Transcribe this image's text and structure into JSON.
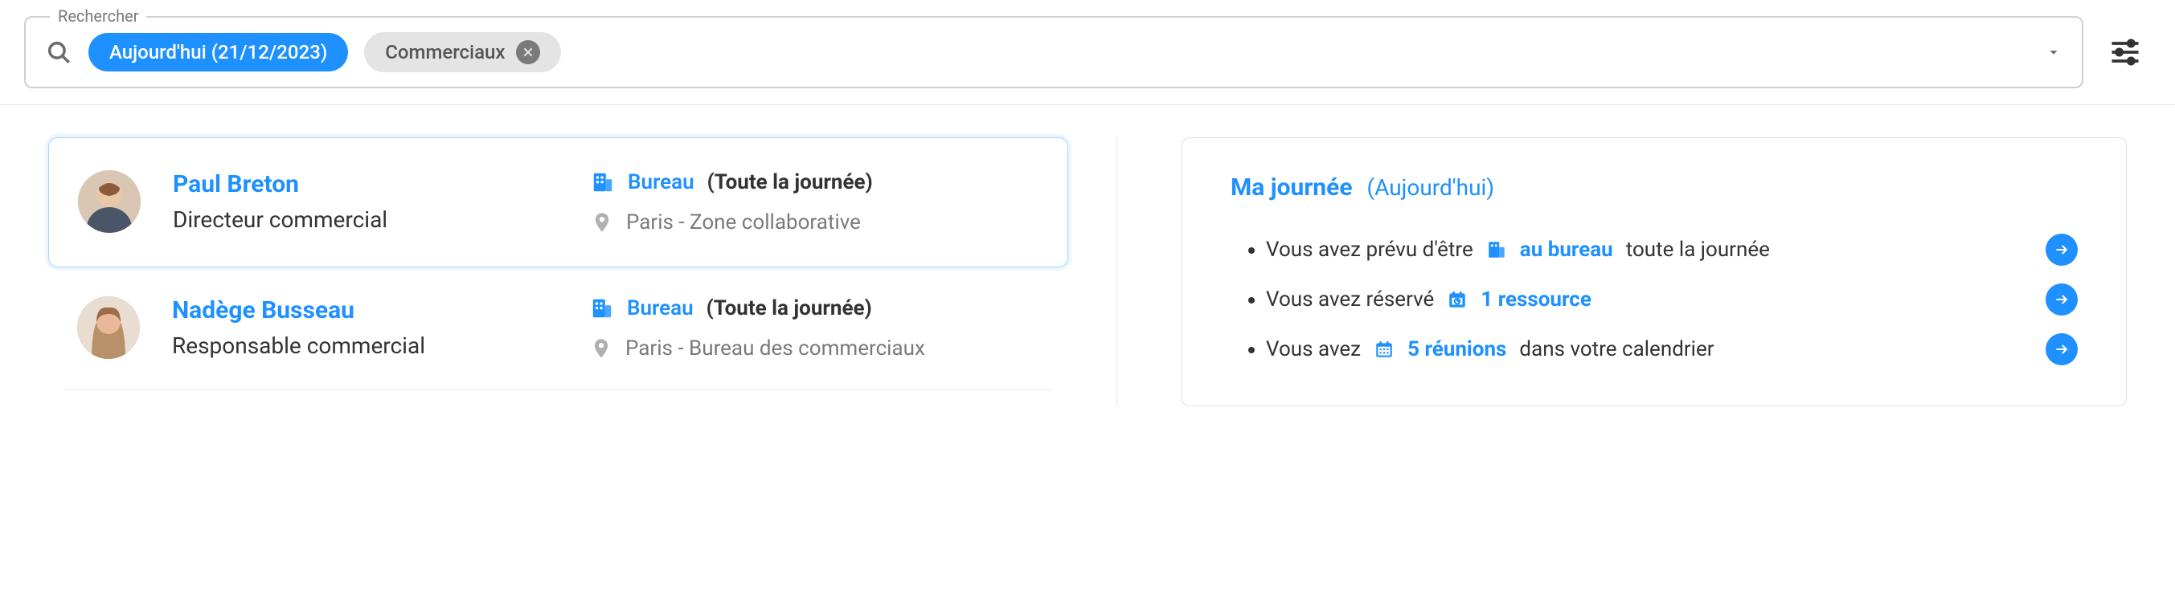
{
  "search": {
    "legend": "Rechercher",
    "chips": [
      {
        "label": "Aujourd'hui (21/12/2023)",
        "type": "blue"
      },
      {
        "label": "Commerciaux",
        "type": "grey",
        "removable": true
      }
    ]
  },
  "people": [
    {
      "name": "Paul Breton",
      "title": "Directeur commercial",
      "status": "Bureau",
      "duration": "(Toute la journée)",
      "place": "Paris - Zone collaborative",
      "selected": true
    },
    {
      "name": "Nadège Busseau",
      "title": "Responsable commercial",
      "status": "Bureau",
      "duration": "(Toute la journée)",
      "place": "Paris - Bureau des commerciaux",
      "selected": false
    }
  ],
  "day": {
    "title": "Ma journée",
    "subtitle": "(Aujourd'hui)",
    "items": [
      {
        "prefix": "Vous avez prévu d'être",
        "icon": "building",
        "link": "au bureau",
        "suffix": "toute la journée"
      },
      {
        "prefix": "Vous avez réservé",
        "icon": "calendar-clock",
        "link": "1 ressource",
        "suffix": ""
      },
      {
        "prefix": "Vous avez",
        "icon": "calendar-grid",
        "link": "5 réunions",
        "suffix": "dans votre calendrier"
      }
    ]
  }
}
